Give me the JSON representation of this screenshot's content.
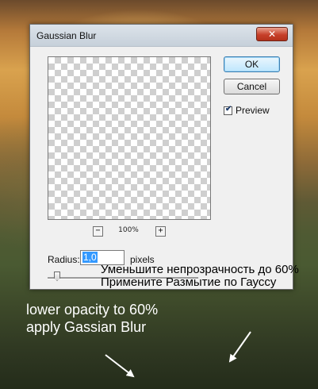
{
  "dialog": {
    "title": "Gaussian Blur",
    "close_icon": "close-icon",
    "ok_label": "OK",
    "cancel_label": "Cancel",
    "preview_label": "Preview",
    "preview_checked": true,
    "zoom_out_label": "−",
    "zoom_in_label": "+",
    "zoom_level": "100%",
    "radius_label": "Radius:",
    "radius_value": "1,0",
    "radius_units": "pixels"
  },
  "annotations": {
    "ru_line1": "Уменьшите непрозрачность до 60%",
    "ru_line2": "Примените Размытие по Гауссу",
    "en_line1": "lower opacity to 60%",
    "en_line2": "apply Gassian Blur"
  },
  "colors": {
    "default_button": "#bee6fd",
    "close_button": "#c7402a",
    "arrow": "#ffffff"
  }
}
